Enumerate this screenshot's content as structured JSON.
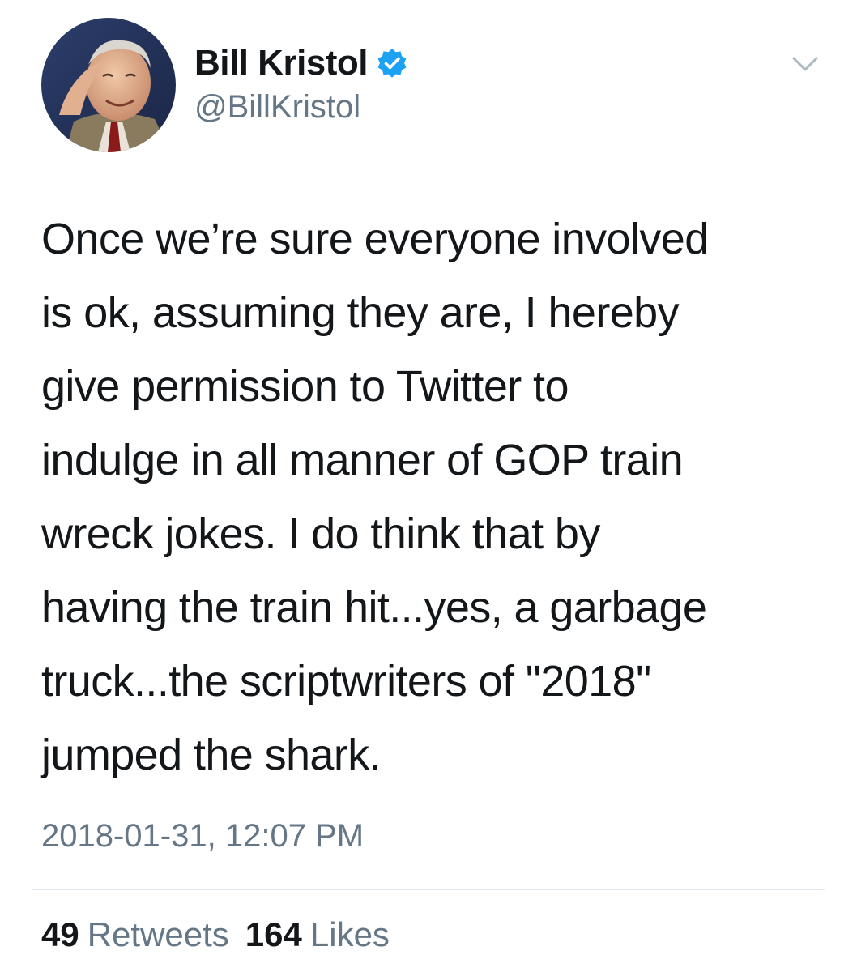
{
  "author": {
    "display_name": "Bill Kristol",
    "handle": "@BillKristol",
    "verified": true
  },
  "tweet": {
    "text": "Once we’re sure everyone involved\nis ok, assuming they are, I hereby\ngive permission to Twitter to\nindulge in all manner of GOP train\nwreck jokes. I do think that by\nhaving the train hit...yes, a garbage\ntruck...the scriptwriters of \"2018\"\njumped the shark.",
    "timestamp": "2018-01-31, 12:07 PM"
  },
  "stats": {
    "retweets_count": "49",
    "retweets_label": "Retweets",
    "likes_count": "164",
    "likes_label": "Likes"
  },
  "icons": {
    "verified": "verified-badge-icon",
    "caret": "chevron-down-icon"
  },
  "colors": {
    "verified_blue": "#1da1f2",
    "secondary_text": "#657786",
    "primary_text": "#14171a",
    "divider": "#e1e8ed"
  }
}
